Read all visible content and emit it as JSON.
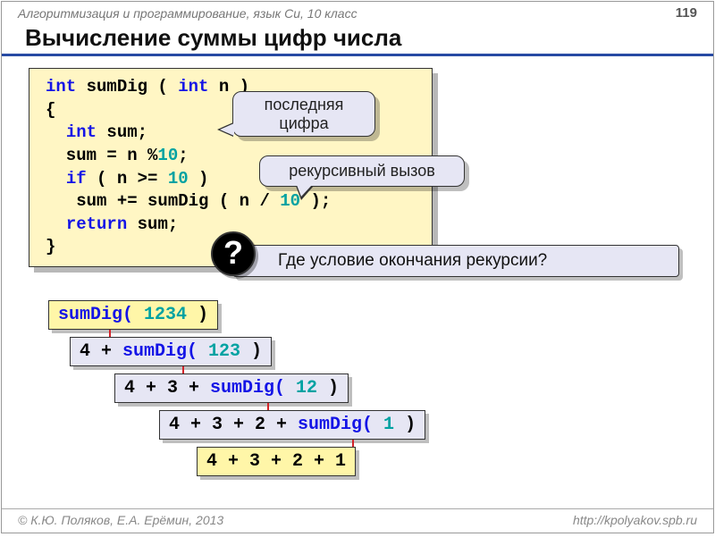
{
  "header": {
    "course": "Алгоритмизация и программирование, язык Си, 10 класс",
    "page": "119"
  },
  "title": "Вычисление суммы цифр числа",
  "code": {
    "l1a": "int",
    "l1b": " sumDig ( ",
    "l1c": "int",
    "l1d": " n )",
    "l2": "{",
    "l3a": "  ",
    "l3b": "int",
    "l3c": " sum;",
    "l4a": "  sum = n %",
    "l4b": "10",
    "l4c": ";",
    "l5a": "  ",
    "l5b": "if",
    "l5c": " ( n >= ",
    "l5d": "10",
    "l5e": " )",
    "l6a": "   sum += sumDig ( n / ",
    "l6b": "10",
    "l6c": " );",
    "l7a": "  ",
    "l7b": "return",
    "l7c": " sum;",
    "l8": "}"
  },
  "callouts": {
    "last_digit": "последняя\nцифра",
    "recursive_call": "рекурсивный вызов"
  },
  "question": {
    "mark": "?",
    "text": "Где условие окончания рекурсии?"
  },
  "trace": {
    "s1_fn": "sumDig(",
    "s1_arg": " 1234 ",
    "s1_end": ")",
    "s2_pre": "4 + ",
    "s2_fn": "sumDig(",
    "s2_arg": " 123 ",
    "s2_end": ")",
    "s3_pre": "4 + 3 + ",
    "s3_fn": "sumDig(",
    "s3_arg": " 12 ",
    "s3_end": ")",
    "s4_pre": "4 + 3 + 2 + ",
    "s4_fn": "sumDig(",
    "s4_arg": " 1 ",
    "s4_end": ")",
    "s5": "4 + 3 + 2 + 1"
  },
  "footer": {
    "left": "© К.Ю. Поляков, Е.А. Ерёмин, 2013",
    "right": "http://kpolyakov.spb.ru"
  }
}
